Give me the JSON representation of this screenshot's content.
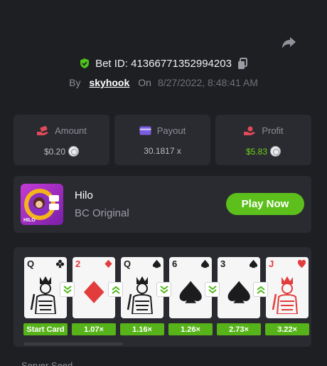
{
  "bet": {
    "id_label": "Bet ID: 41366771352994203",
    "by_label": "By",
    "user": "skyhook",
    "on_label": "On",
    "date": "8/27/2022, 8:48:41 AM"
  },
  "stats": [
    {
      "label": "Amount",
      "value": "$0.20",
      "icon": "amount-hand-icon",
      "color": "#e04a5a"
    },
    {
      "label": "Payout",
      "value": "30.1817 x",
      "icon": "wallet-card-icon",
      "color": "#7b5ce3"
    },
    {
      "label": "Profit",
      "value": "$5.83",
      "icon": "profit-hand-icon",
      "color": "#e04a5a"
    }
  ],
  "game": {
    "title": "Hilo",
    "subtitle": "BC Original",
    "thumb_text": "HILO",
    "play_label": "Play Now"
  },
  "cards": [
    {
      "rank": "Q",
      "suit": "clubs",
      "color": "#1c1c1f",
      "mult": "Start Card"
    },
    {
      "rank": "2",
      "suit": "diamonds",
      "color": "#e23c3c",
      "mult": "1.07×"
    },
    {
      "rank": "Q",
      "suit": "spades",
      "color": "#1c1c1f",
      "mult": "1.16×"
    },
    {
      "rank": "6",
      "suit": "spades",
      "color": "#1c1c1f",
      "mult": "1.26×"
    },
    {
      "rank": "3",
      "suit": "spades",
      "color": "#1c1c1f",
      "mult": "2.73×"
    },
    {
      "rank": "J",
      "suit": "hearts",
      "color": "#e23c3c",
      "mult": "3.22×"
    }
  ],
  "arrows": [
    "down",
    "up",
    "down",
    "down",
    "up"
  ],
  "colors": {
    "accent_green": "#5cbf1c",
    "panel": "#2a2b30",
    "background": "#1e1f23"
  },
  "footer": {
    "next_label": "Server Seed"
  }
}
